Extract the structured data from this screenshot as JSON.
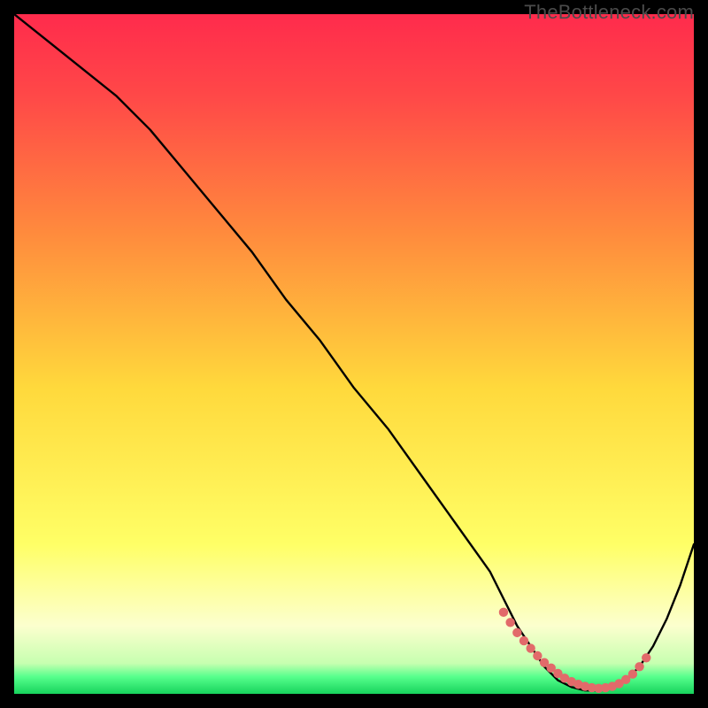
{
  "watermark": "TheBottleneck.com",
  "colors": {
    "gradient_top": "#ff2b4c",
    "gradient_mid1": "#ff8a3d",
    "gradient_mid2": "#ffd93c",
    "gradient_mid3": "#fdffa8",
    "gradient_bottom_band": "#2cff6e",
    "curve": "#000000",
    "dots": "#e26a6a",
    "frame_bg": "#000000"
  },
  "chart_data": {
    "type": "line",
    "title": "",
    "xlabel": "",
    "ylabel": "",
    "xlim": [
      0,
      100
    ],
    "ylim": [
      0,
      100
    ],
    "series": [
      {
        "name": "bottleneck-curve",
        "x": [
          0,
          5,
          10,
          15,
          20,
          25,
          30,
          35,
          40,
          45,
          50,
          55,
          60,
          65,
          70,
          72,
          74,
          76,
          78,
          80,
          82,
          84,
          86,
          88,
          90,
          92,
          94,
          96,
          98,
          100
        ],
        "values": [
          100,
          96,
          92,
          88,
          83,
          77,
          71,
          65,
          58,
          52,
          45,
          39,
          32,
          25,
          18,
          14,
          10,
          7,
          4,
          2,
          1,
          0.5,
          0.5,
          1,
          2,
          4,
          7,
          11,
          16,
          22
        ]
      }
    ],
    "highlight_dots": {
      "name": "sweet-spot-dots",
      "x": [
        72,
        73,
        74,
        75,
        76,
        77,
        78,
        79,
        80,
        81,
        82,
        83,
        84,
        85,
        86,
        87,
        88,
        89,
        90,
        91,
        92,
        93
      ],
      "values": [
        12,
        10.5,
        9,
        7.8,
        6.7,
        5.6,
        4.6,
        3.8,
        3.0,
        2.3,
        1.8,
        1.4,
        1.1,
        0.9,
        0.8,
        0.9,
        1.1,
        1.5,
        2.1,
        2.9,
        4.0,
        5.3
      ]
    }
  }
}
